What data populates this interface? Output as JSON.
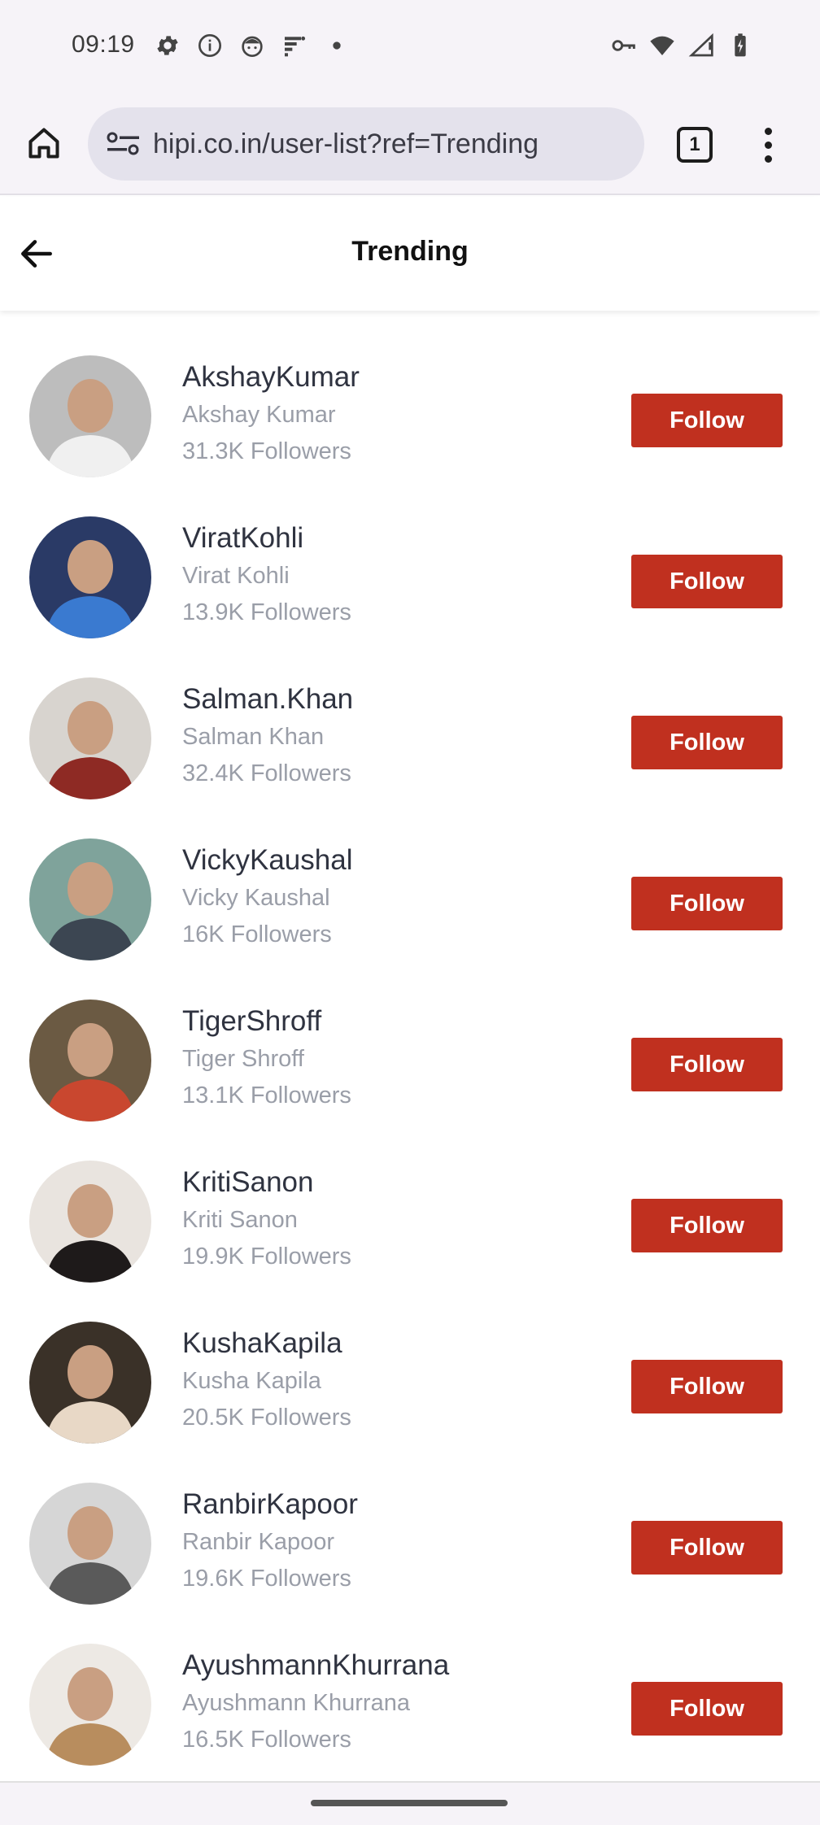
{
  "status_bar": {
    "time": "09:19",
    "left_icons": [
      "settings-icon",
      "info-icon",
      "face-icon",
      "signal-bars-icon",
      "dot-icon"
    ],
    "right_icons": [
      "key-icon",
      "wifi-icon",
      "cell-signal-icon",
      "battery-icon"
    ]
  },
  "browser": {
    "url": "hipi.co.in/user-list?ref=Trending",
    "tab_count": "1"
  },
  "header": {
    "title": "Trending"
  },
  "users": [
    {
      "handle": "AkshayKumar",
      "name": "Akshay Kumar",
      "followers": "31.3K Followers",
      "follow_label": "Follow",
      "avatar_bg": "#bdbdbd",
      "avatar_fg": "#f0f0f0"
    },
    {
      "handle": "ViratKohli",
      "name": "Virat Kohli",
      "followers": "13.9K Followers",
      "follow_label": "Follow",
      "avatar_bg": "#2a3a66",
      "avatar_fg": "#3a7ad0"
    },
    {
      "handle": "Salman.Khan",
      "name": "Salman Khan",
      "followers": "32.4K Followers",
      "follow_label": "Follow",
      "avatar_bg": "#d8d4cf",
      "avatar_fg": "#8e2a24"
    },
    {
      "handle": "VickyKaushal",
      "name": "Vicky Kaushal",
      "followers": "16K Followers",
      "follow_label": "Follow",
      "avatar_bg": "#7fa39b",
      "avatar_fg": "#3c4652"
    },
    {
      "handle": "TigerShroff",
      "name": "Tiger Shroff",
      "followers": "13.1K Followers",
      "follow_label": "Follow",
      "avatar_bg": "#6b5a43",
      "avatar_fg": "#c9472f"
    },
    {
      "handle": "KritiSanon",
      "name": "Kriti Sanon",
      "followers": "19.9K Followers",
      "follow_label": "Follow",
      "avatar_bg": "#e9e4df",
      "avatar_fg": "#1e1a1a"
    },
    {
      "handle": "KushaKapila",
      "name": "Kusha Kapila",
      "followers": "20.5K Followers",
      "follow_label": "Follow",
      "avatar_bg": "#3a3128",
      "avatar_fg": "#e8d8c6"
    },
    {
      "handle": "RanbirKapoor",
      "name": "Ranbir Kapoor",
      "followers": "19.6K Followers",
      "follow_label": "Follow",
      "avatar_bg": "#d6d6d6",
      "avatar_fg": "#5a5a5a"
    },
    {
      "handle": "AyushmannKhurrana",
      "name": "Ayushmann Khurrana",
      "followers": "16.5K Followers",
      "follow_label": "Follow",
      "avatar_bg": "#ede9e4",
      "avatar_fg": "#b88d5e"
    }
  ],
  "colors": {
    "follow_button": "#c0301f",
    "handle_text": "#2f3340",
    "secondary_text": "#9a9ea8",
    "chrome_background": "#f6f3f8",
    "url_pill": "#e4e2ec"
  }
}
